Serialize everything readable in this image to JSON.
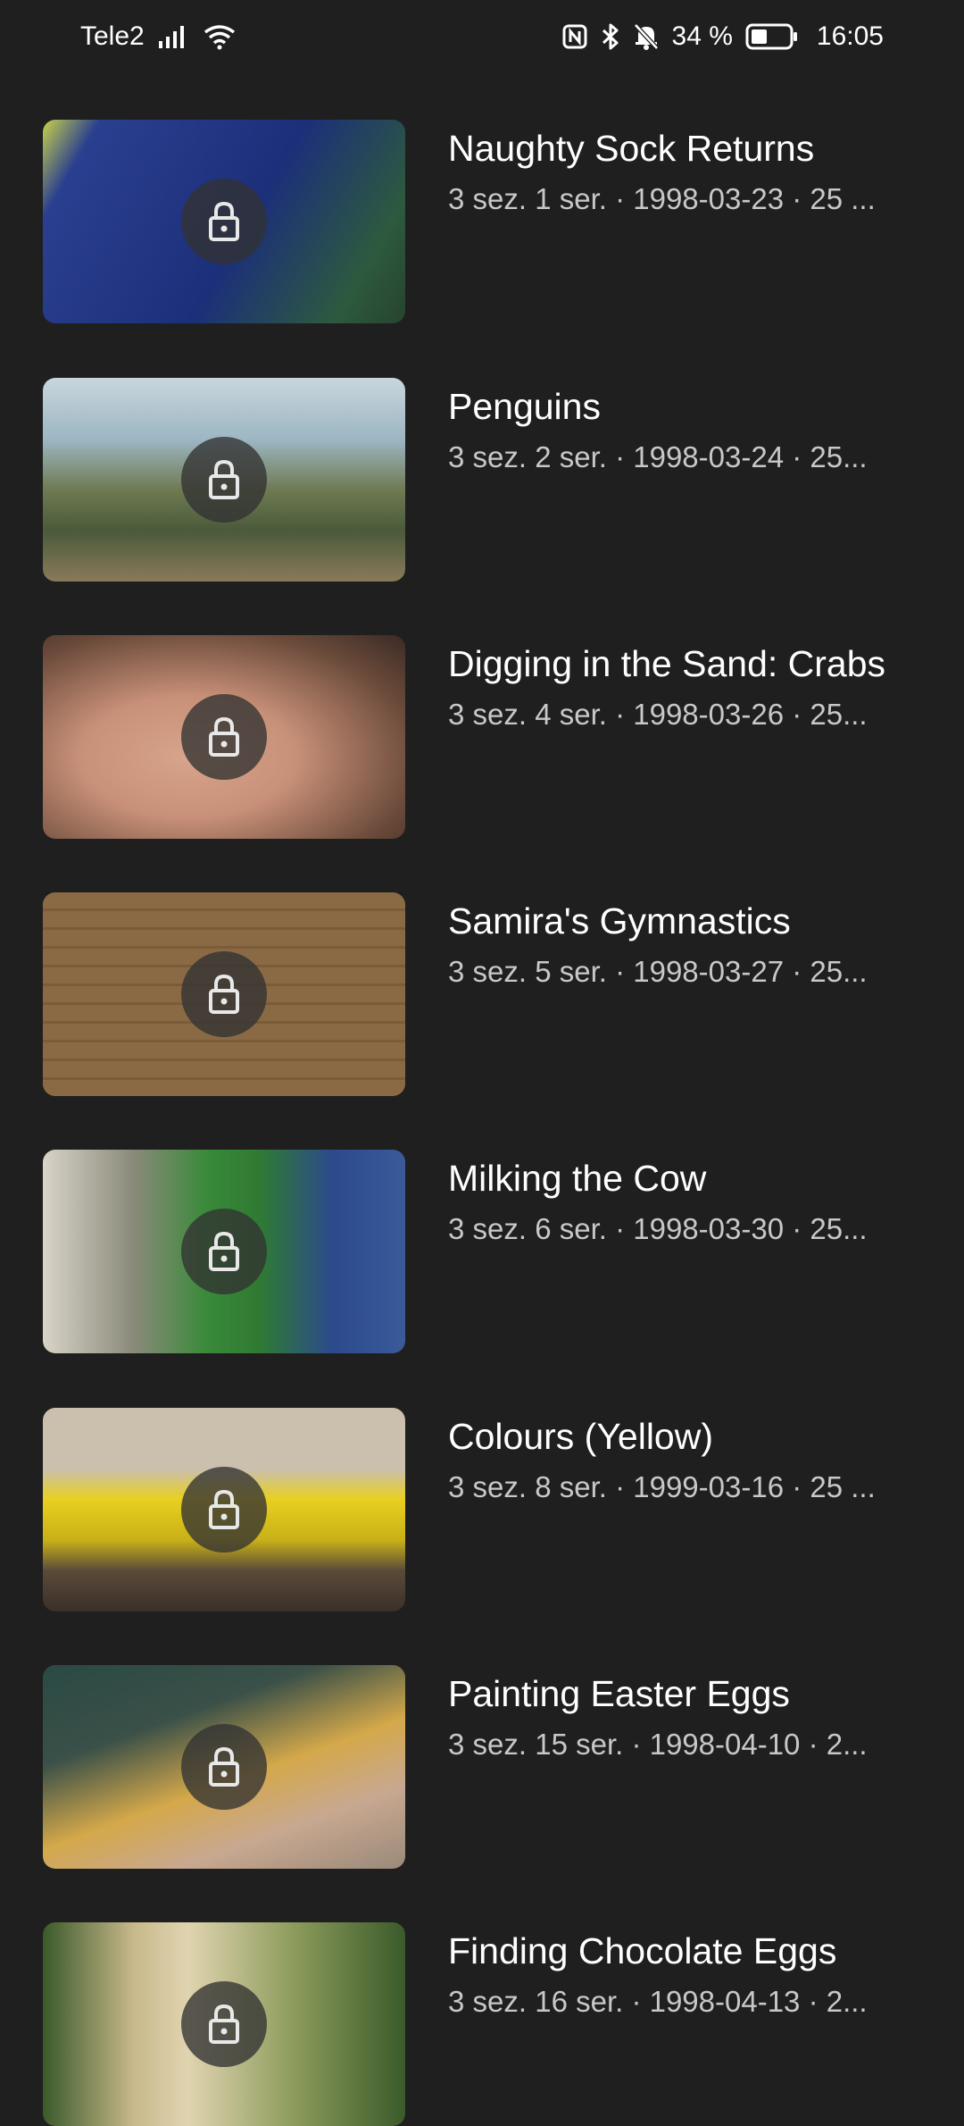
{
  "status_bar": {
    "carrier": "Tele2",
    "battery_percent": "34 %",
    "time": "16:05",
    "icons": [
      "signal-icon",
      "wifi-icon",
      "nfc-icon",
      "bluetooth-icon",
      "notifications-off-icon",
      "battery-icon"
    ]
  },
  "episodes": [
    {
      "title": "Naughty Sock Returns",
      "meta": "3 sez. 1 ser. · 1998-03-23 · 25 ...",
      "locked": true,
      "colors": [
        "#2a3f8f",
        "#5a6b7c",
        "#2d5a3e"
      ]
    },
    {
      "title": "Penguins",
      "meta": "3 sez. 2 ser. · 1998-03-24 · 25...",
      "locked": true,
      "colors": [
        "#4a5a3a",
        "#9db7c4",
        "#8a7a5a"
      ]
    },
    {
      "title": "Digging in the Sand: Crabs",
      "meta": "3 sez. 4 ser. · 1998-03-26 · 25...",
      "locked": true,
      "colors": [
        "#3a2a24",
        "#c89078",
        "#6a4a3a"
      ]
    },
    {
      "title": "Samira's Gymnastics",
      "meta": "3 sez. 5 ser. · 1998-03-27 · 25...",
      "locked": true,
      "colors": [
        "#8a6a44",
        "#b08a5a",
        "#6a5036"
      ]
    },
    {
      "title": "Milking the Cow",
      "meta": "3 sez. 6 ser. · 1998-03-30 · 25...",
      "locked": true,
      "colors": [
        "#2c4a8c",
        "#3a8a3a",
        "#5a6a8a"
      ]
    },
    {
      "title": "Colours (Yellow)",
      "meta": "3 sez. 8 ser. · 1999-03-16 · 25 ...",
      "locked": true,
      "colors": [
        "#cbbfae",
        "#e8d020",
        "#5a4a3a"
      ]
    },
    {
      "title": "Painting Easter Eggs",
      "meta": "3 sez. 15 ser. · 1998-04-10 · 2...",
      "locked": true,
      "colors": [
        "#2a4a44",
        "#d4a84a",
        "#9a8a7a"
      ]
    },
    {
      "title": "Finding Chocolate Eggs",
      "meta": "3 sez. 16 ser. · 1998-04-13 · 2...",
      "locked": true,
      "colors": [
        "#3a5a2a",
        "#c8b88a",
        "#8a9a5a"
      ]
    }
  ]
}
